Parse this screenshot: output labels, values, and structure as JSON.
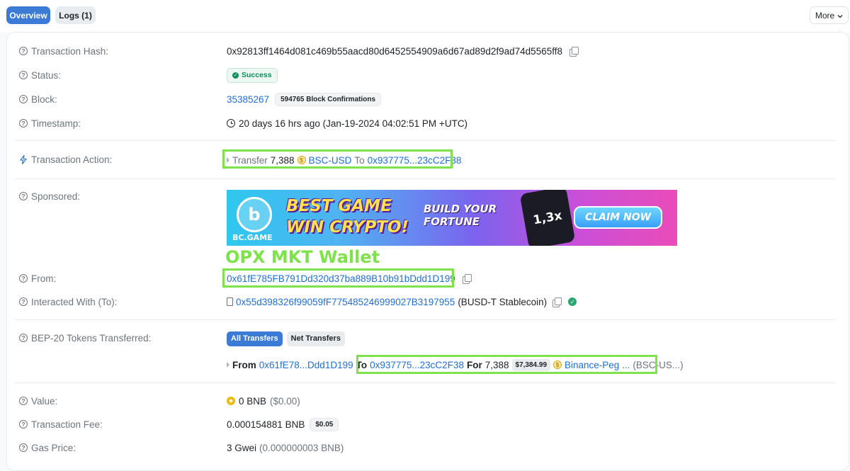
{
  "tabs": {
    "overview": "Overview",
    "logs": "Logs (1)",
    "more": "More"
  },
  "rows": {
    "tx_hash": {
      "label": "Transaction Hash:",
      "value": "0x92813ff1464d081c469b55aacd80d6452554909a6d67ad89d2f9ad74d5565ff8"
    },
    "status": {
      "label": "Status:",
      "value": "Success"
    },
    "block": {
      "label": "Block:",
      "number": "35385267",
      "confirmations": "594765 Block Confirmations"
    },
    "timestamp": {
      "label": "Timestamp:",
      "value": "20 days 16 hrs ago (Jan-19-2024 04:02:51 PM +UTC)"
    },
    "action": {
      "label": "Transaction Action:",
      "verb": "Transfer",
      "amount": "7,388",
      "token": "BSC-USD",
      "to_word": "To",
      "to_address": "0x937775...23cC2F38"
    },
    "sponsored": {
      "label": "Sponsored:"
    },
    "from": {
      "label": "From:",
      "value": "0x61fE785FB791Dd320d37ba889B10b91bDdd1D199"
    },
    "interacted": {
      "label": "Interacted With (To):",
      "address": "0x55d398326f99059fF775485246999027B3197955",
      "name": "(BUSD-T Stablecoin)"
    },
    "tokens": {
      "label": "BEP-20 Tokens Transferred:",
      "all_transfers": "All Transfers",
      "net_transfers": "Net Transfers",
      "from_word": "From",
      "from_address": "0x61fE78...Ddd1D199",
      "to_word": "To",
      "to_address": "0x937775...23cC2F38",
      "for_word": "For",
      "amount": "7,388",
      "usd_value": "$7,384.99",
      "token_name": "Binance-Peg ...",
      "token_symbol": "(BSC-US...)"
    },
    "value": {
      "label": "Value:",
      "amount": "0 BNB",
      "usd": "($0.00)"
    },
    "fee": {
      "label": "Transaction Fee:",
      "amount": "0.000154881 BNB",
      "usd": "$0.05"
    },
    "gas": {
      "label": "Gas Price:",
      "amount": "3 Gwei",
      "detail": "(0.000000003 BNB)"
    }
  },
  "ad": {
    "logo_text": "BC.GAME",
    "logo_letter": "b",
    "title_line1": "BEST GAME",
    "title_line2": "WIN CRYPTO!",
    "subtitle": "BUILD YOUR FORTUNE",
    "multiplier": "1,3x",
    "cta": "CLAIM NOW"
  },
  "annotation": "OPX MKT Wallet",
  "colors": {
    "accent": "#3b7bd6",
    "link": "#1e6fd9",
    "success": "#0c8f5c",
    "highlight": "#7ee34a"
  }
}
